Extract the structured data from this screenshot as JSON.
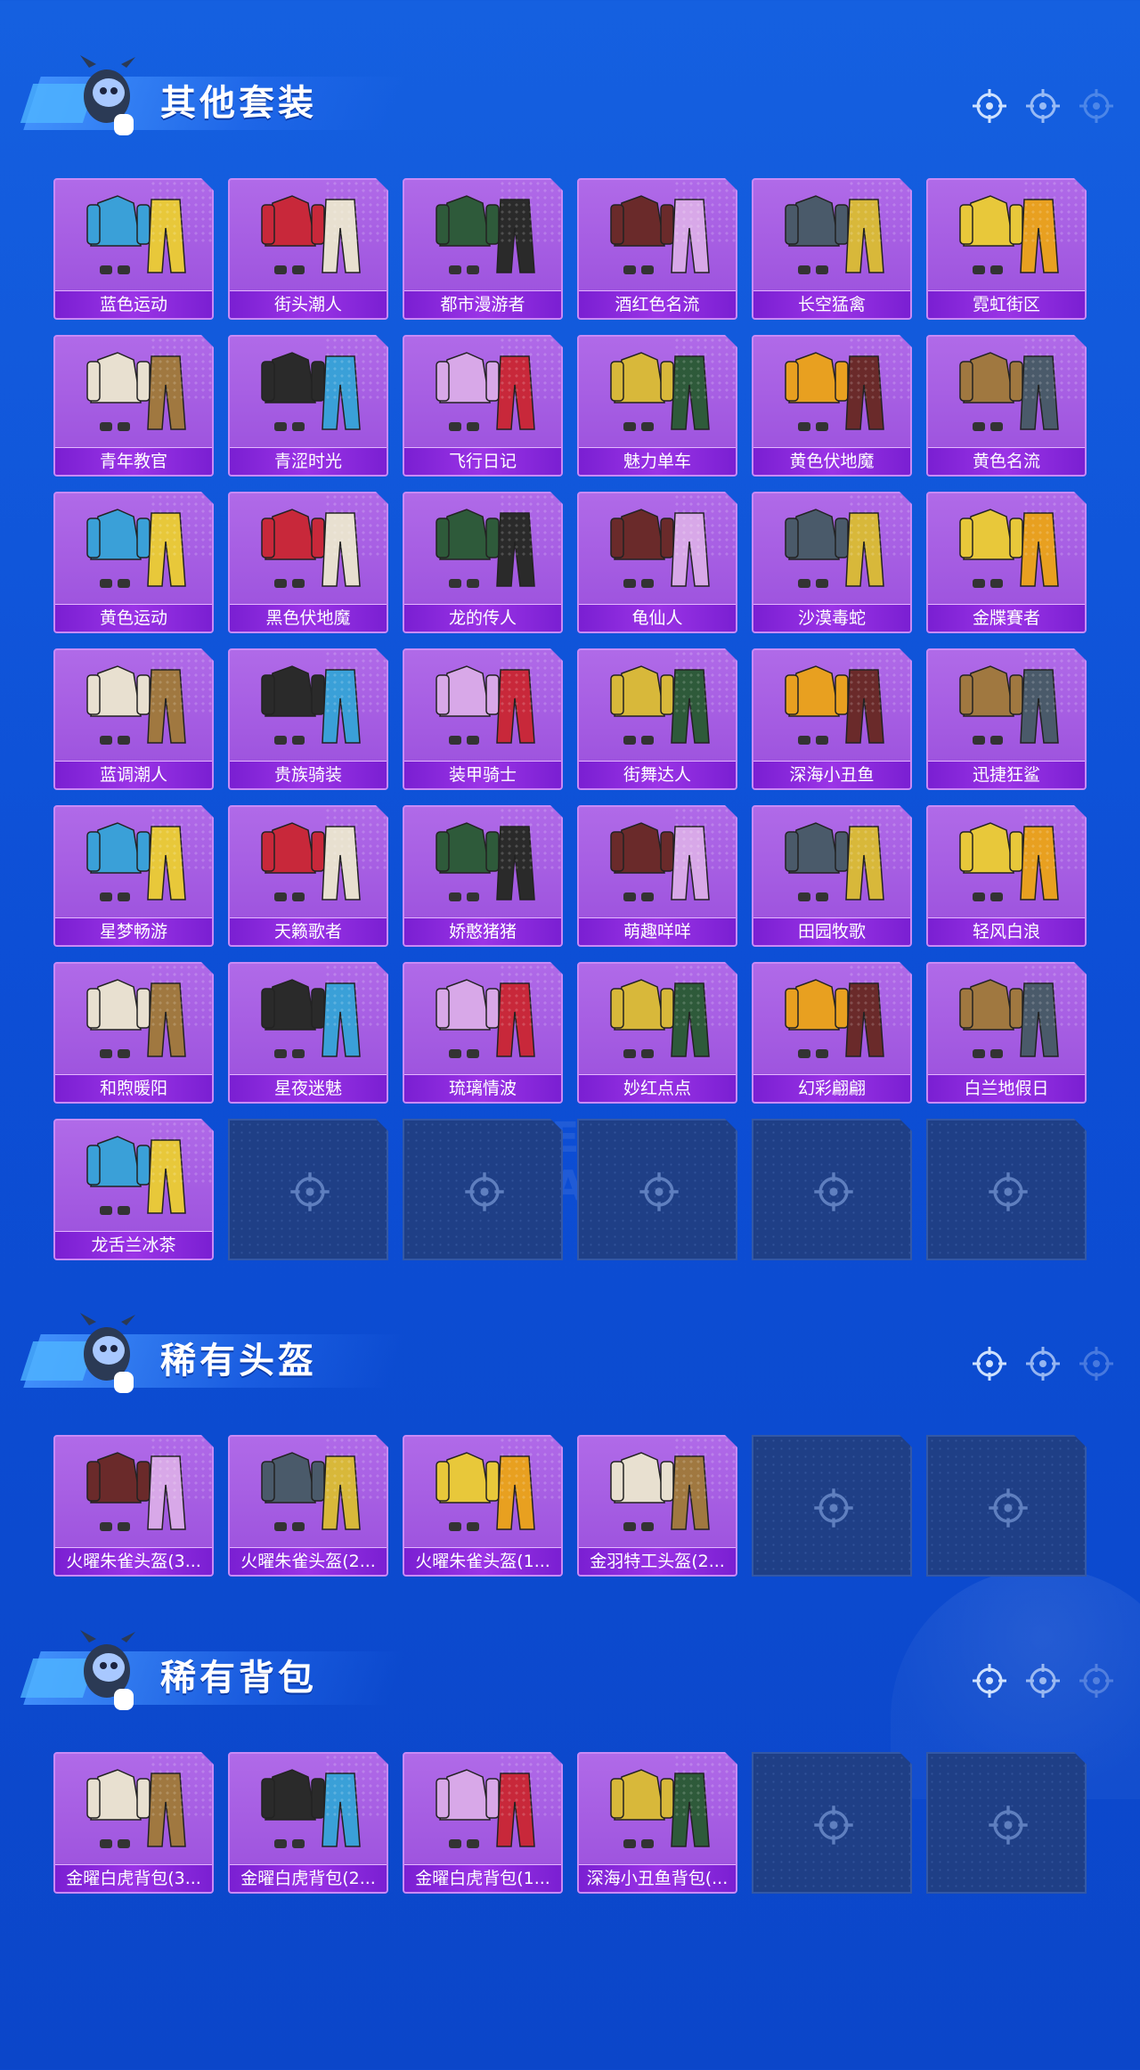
{
  "colors": {
    "background": "#0d4fd6",
    "card": "#9a4fdc",
    "label_bar": "#8a28de",
    "empty_slot": "#1f3f86"
  },
  "watermark": "GAME FOR PEACE",
  "sections": [
    {
      "title": "其他套装",
      "items": [
        "蓝色运动",
        "街头潮人",
        "都市漫游者",
        "酒红色名流",
        "长空猛禽",
        "霓虹街区",
        "青年教官",
        "青涩时光",
        "飞行日记",
        "魅力单车",
        "黄色伏地魔",
        "黄色名流",
        "黄色运动",
        "黑色伏地魔",
        "龙的传人",
        "龟仙人",
        "沙漠毒蛇",
        "金牒賽者",
        "蓝调潮人",
        "贵族骑装",
        "装甲骑士",
        "街舞达人",
        "深海小丑鱼",
        "迅捷狂鲨",
        "星梦畅游",
        "天籁歌者",
        "娇憨猪猪",
        "萌趣咩咩",
        "田园牧歌",
        "轻风白浪",
        "和煦暖阳",
        "星夜迷魅",
        "琉璃情波",
        "妙红点点",
        "幻彩翩翩",
        "白兰地假日",
        "龙舌兰冰茶"
      ],
      "empty_slots": 5
    },
    {
      "title": "稀有头盔",
      "items": [
        "火曜朱雀头盔(3...",
        "火曜朱雀头盔(2...",
        "火曜朱雀头盔(1...",
        "金羽特工头盔(2..."
      ],
      "empty_slots": 2
    },
    {
      "title": "稀有背包",
      "items": [
        "金曜白虎背包(3...",
        "金曜白虎背包(2...",
        "金曜白虎背包(1...",
        "深海小丑鱼背包(..."
      ],
      "empty_slots": 2
    }
  ]
}
